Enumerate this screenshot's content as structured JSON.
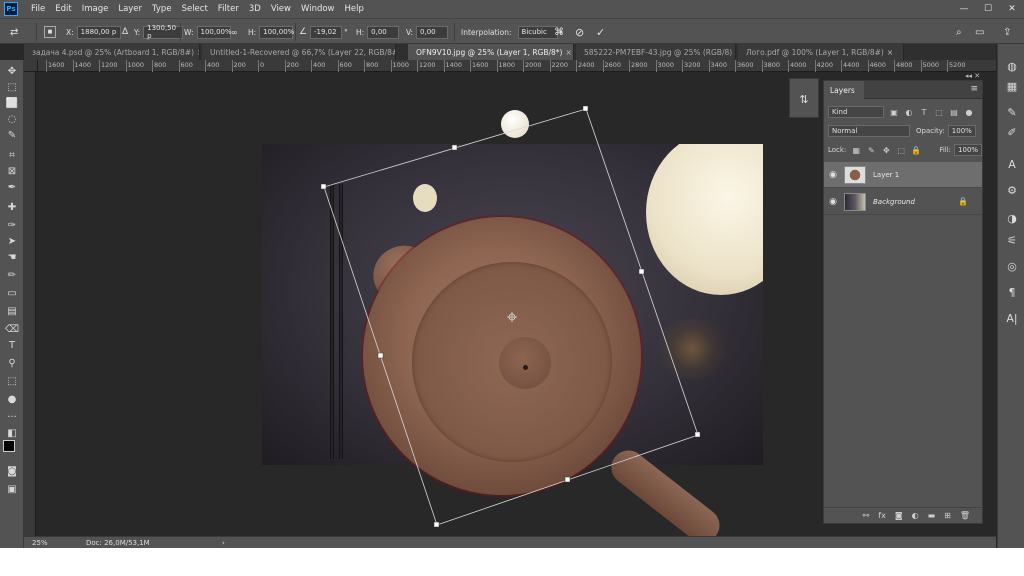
{
  "menubar": {
    "logo": "Ps",
    "items": [
      "File",
      "Edit",
      "Image",
      "Layer",
      "Type",
      "Select",
      "Filter",
      "3D",
      "View",
      "Window",
      "Help"
    ],
    "window_controls": {
      "minimize": "—",
      "maximize": "☐",
      "close": "✕"
    }
  },
  "options": {
    "x_label": "X:",
    "x_value": "1880,00 p",
    "y_label": "Y:",
    "y_value": "1300,50 p",
    "w_label": "W:",
    "w_value": "100,00%",
    "h_label": "H:",
    "h_value": "100,00%",
    "angle_value": "-19,02",
    "angle_unit": "°",
    "hskew_label": "H:",
    "hskew_value": "0,00",
    "vskew_label": "V:",
    "vskew_value": "0,00",
    "interp_label": "Interpolation:",
    "interp_value": "Bicubic",
    "cancel_icon": "⊘",
    "commit_icon": "✓"
  },
  "tabs": [
    {
      "label": "задача 4.psd @ 25% (Artboard 1, RGB/8#)",
      "close": "×"
    },
    {
      "label": "Untitled-1-Recovered @ 66,7% (Layer 22, RGB/8#)",
      "close": "×"
    },
    {
      "label": "OFN9V10.jpg @ 25% (Layer 1, RGB/8*)",
      "close": "×"
    },
    {
      "label": "585222-PM7EBF-43.jpg @ 25% (RGB/8)",
      "close": "×"
    },
    {
      "label": "Лого.pdf @ 100% (Layer 1, RGB/8#)",
      "close": "×"
    }
  ],
  "ruler_top": [
    "1600",
    "1400",
    "1200",
    "1000",
    "800",
    "600",
    "400",
    "200",
    "0",
    "200",
    "400",
    "600",
    "800",
    "1000",
    "1200",
    "1400",
    "1600",
    "1800",
    "2000",
    "2200",
    "2400",
    "2600",
    "2800",
    "3000",
    "3200",
    "3400",
    "3600",
    "3800",
    "4000",
    "4200",
    "4400",
    "4600",
    "4800",
    "5000",
    "5200"
  ],
  "layers": {
    "tab_label": "Layers",
    "search_placeholder": "Kind",
    "blend_mode": "Normal",
    "opacity_label": "Opacity:",
    "opacity_value": "100%",
    "lock_label": "Lock:",
    "fill_label": "Fill:",
    "fill_value": "100%",
    "items": [
      {
        "name": "Layer 1",
        "selected": true
      },
      {
        "name": "Background",
        "locked": true
      }
    ]
  },
  "status": {
    "zoom": "25%",
    "doc": "Doc: 26,0M/53,1M",
    "arrow": "›"
  },
  "icons": {
    "eye": "👁",
    "lock": "🔒",
    "menu": "≡"
  }
}
